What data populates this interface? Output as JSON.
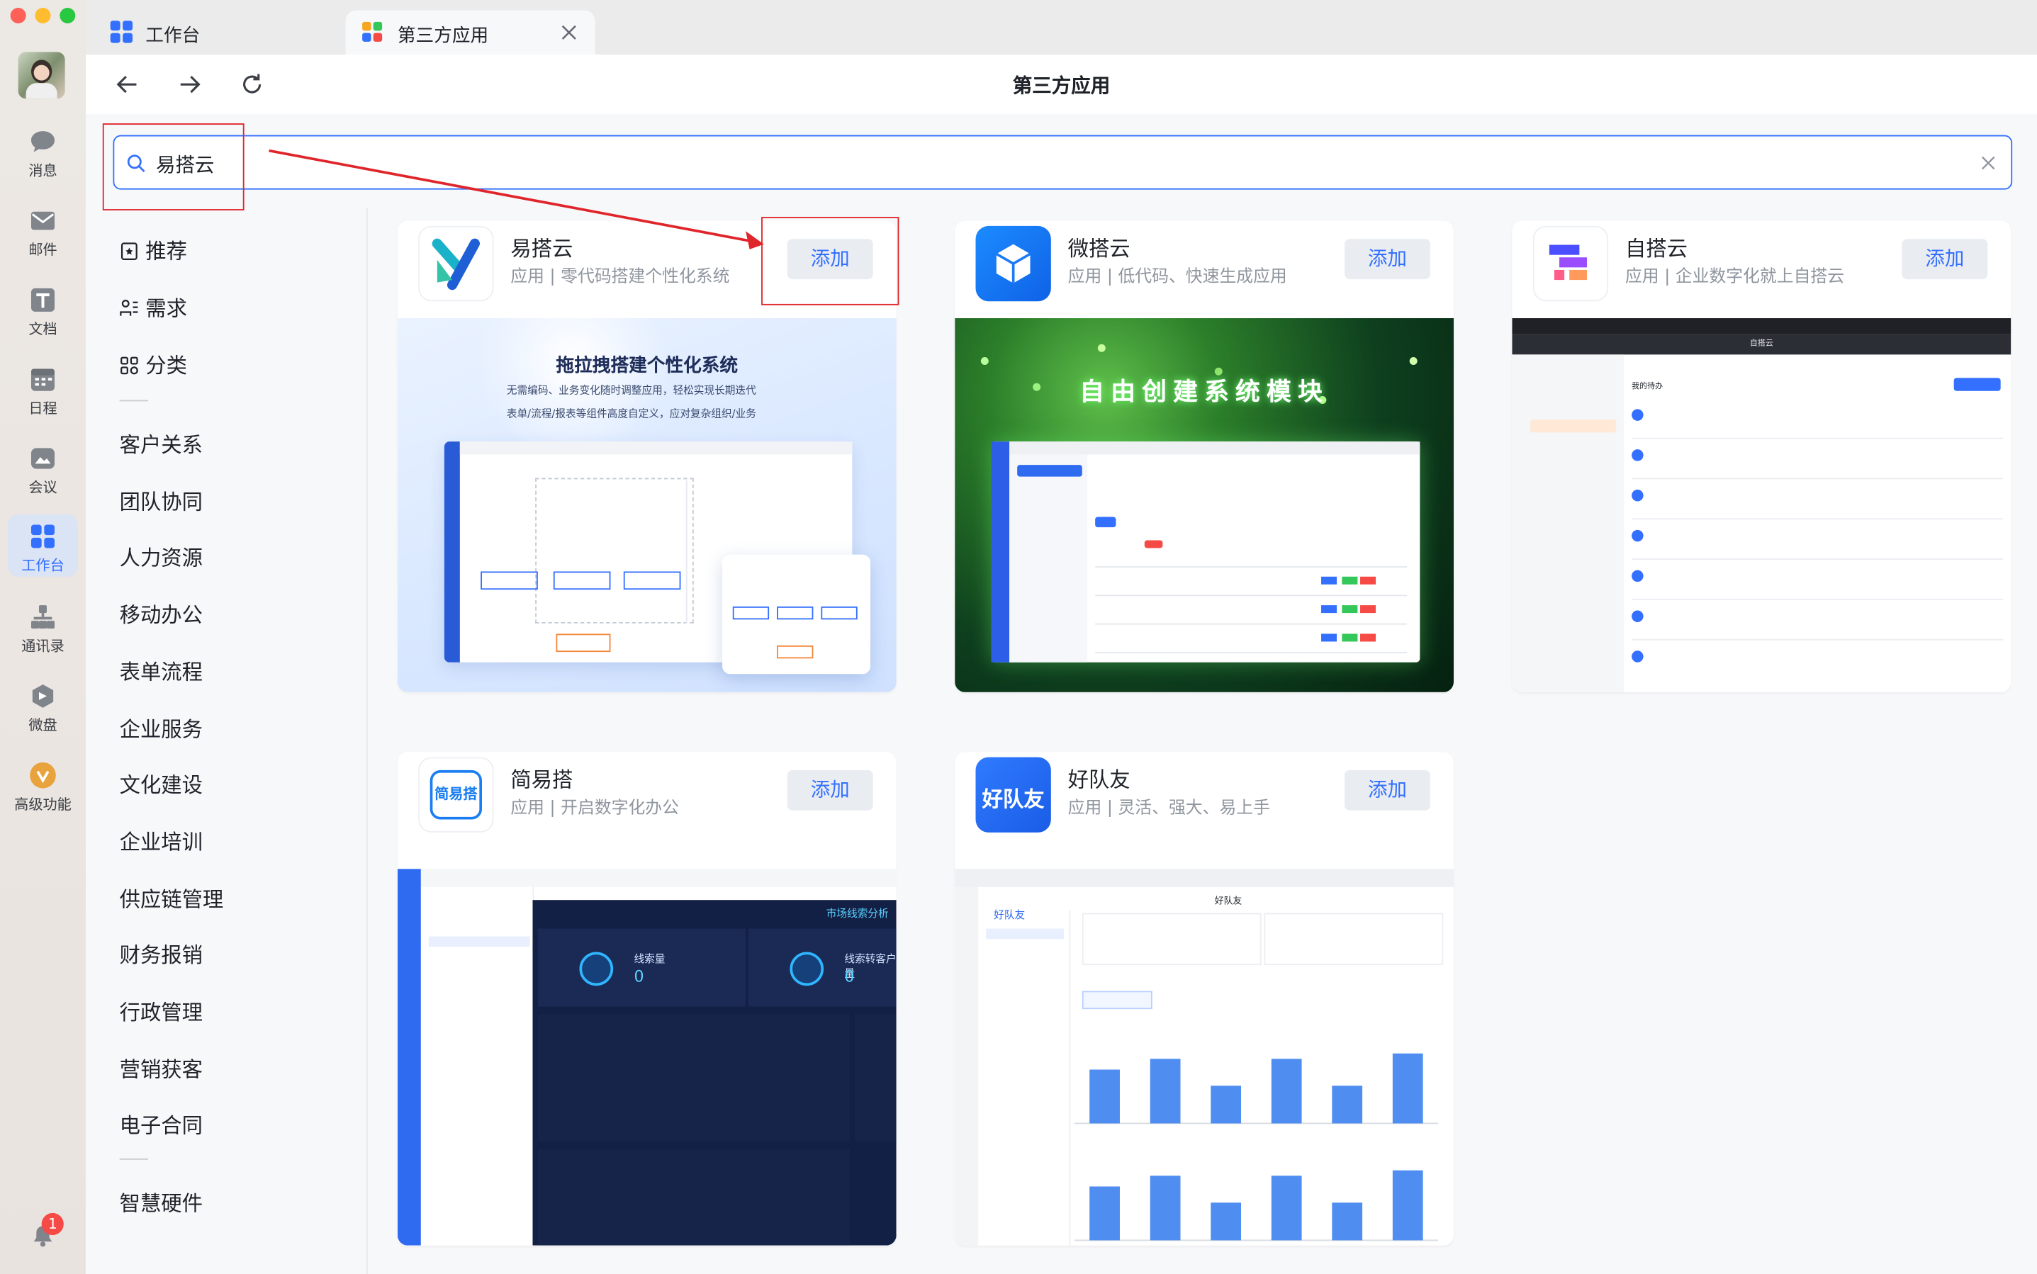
{
  "window": {
    "traffic_lights": [
      "#fe5f57",
      "#febc2e",
      "#28c840"
    ]
  },
  "rail": {
    "items": [
      {
        "label": "消息",
        "icon": "chat-bubble-icon"
      },
      {
        "label": "邮件",
        "icon": "mail-icon"
      },
      {
        "label": "文档",
        "icon": "document-icon"
      },
      {
        "label": "日程",
        "icon": "calendar-icon"
      },
      {
        "label": "会议",
        "icon": "meeting-icon"
      },
      {
        "label": "工作台",
        "icon": "workbench-grid-icon"
      },
      {
        "label": "通讯录",
        "icon": "contacts-icon"
      },
      {
        "label": "微盘",
        "icon": "drive-icon"
      },
      {
        "label": "高级功能",
        "icon": "premium-icon"
      }
    ],
    "notification_count": "1",
    "active_color": "#3370ff"
  },
  "tabs": [
    {
      "label": "工作台"
    },
    {
      "label": "第三方应用"
    }
  ],
  "page": {
    "title": "第三方应用"
  },
  "search": {
    "value": "易搭云"
  },
  "categories": {
    "top": [
      {
        "label": "推荐",
        "icon": "recommend-icon"
      },
      {
        "label": "需求",
        "icon": "needs-icon"
      },
      {
        "label": "分类",
        "icon": "category-icon"
      }
    ],
    "list": [
      "客户关系",
      "团队协同",
      "人力资源",
      "移动办公",
      "表单流程",
      "企业服务",
      "文化建设",
      "企业培训",
      "供应链管理",
      "财务报销",
      "行政管理",
      "营销获客",
      "电子合同"
    ],
    "bottom": [
      "智慧硬件"
    ]
  },
  "apps": [
    {
      "name": "易搭云",
      "desc": "应用 | 零代码搭建个性化系统",
      "add": "添加",
      "shot": {
        "headline": "拖拉拽搭建个性化系统",
        "bullets": [
          "无需编码、业务变化随时调整应用，轻松实现长期迭代",
          "表单/流程/报表等组件高度自定义，应对复杂组织/业务"
        ]
      }
    },
    {
      "name": "微搭云",
      "desc": "应用 | 低代码、快速生成应用",
      "add": "添加",
      "shot": {
        "headline": "自由创建系统模块"
      }
    },
    {
      "name": "自搭云",
      "desc": "应用 | 企业数字化就上自搭云",
      "add": "添加",
      "shot": {
        "title": "自搭云",
        "subtitle": "我的待办"
      }
    },
    {
      "name": "简易搭",
      "desc": "应用 | 开启数字化办公",
      "add": "添加",
      "shot": {
        "panel_title": "市场线索分析",
        "stat1_label": "线索量",
        "stat1_value": "0",
        "stat2_label": "线索转客户量",
        "stat2_value": "0"
      }
    },
    {
      "name": "好队友",
      "desc": "应用 | 灵活、强大、易上手",
      "add": "添加",
      "shot": {
        "title": "好队友",
        "logo": "好队友"
      }
    }
  ],
  "icon_text": {
    "jianyida": "简易搭",
    "haoduiyou": "好队友"
  },
  "chart_mini": {
    "type": "bar",
    "values": [
      10,
      12,
      7,
      12,
      7,
      13
    ]
  }
}
